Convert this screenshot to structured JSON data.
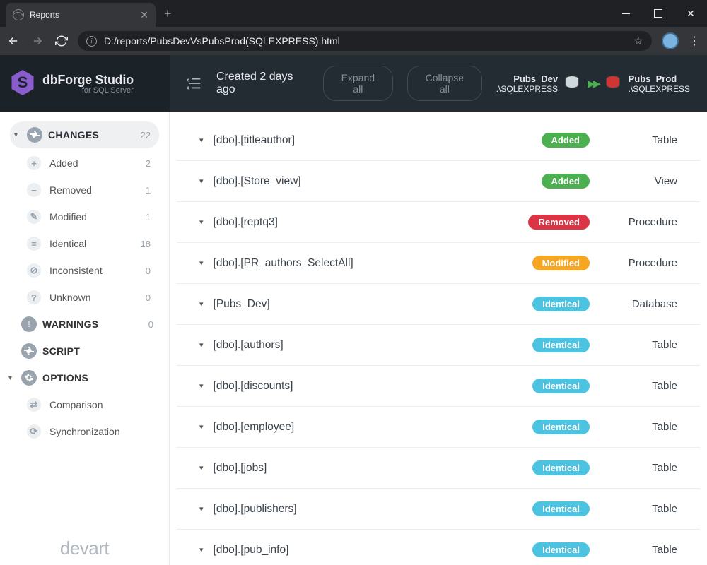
{
  "browser": {
    "tab_title": "Reports",
    "url": "D:/reports/PubsDevVsPubsProd(SQLEXPRESS).html"
  },
  "brand": {
    "title": "dbForge Studio",
    "subtitle": "for SQL Server"
  },
  "header": {
    "created": "Created 2 days ago",
    "expand": "Expand all",
    "collapse": "Collapse all",
    "src_name": "Pubs_Dev",
    "src_srv": ".\\SQLEXPRESS",
    "tgt_name": "Pubs_Prod",
    "tgt_srv": ".\\SQLEXPRESS"
  },
  "sidebar": {
    "changes": {
      "label": "CHANGES",
      "count": "22"
    },
    "items": [
      {
        "label": "Added",
        "count": "2",
        "sym": "+"
      },
      {
        "label": "Removed",
        "count": "1",
        "sym": "−"
      },
      {
        "label": "Modified",
        "count": "1",
        "sym": "✎"
      },
      {
        "label": "Identical",
        "count": "18",
        "sym": "="
      },
      {
        "label": "Inconsistent",
        "count": "0",
        "sym": "⊘"
      },
      {
        "label": "Unknown",
        "count": "0",
        "sym": "?"
      }
    ],
    "warnings": {
      "label": "WARNINGS",
      "count": "0"
    },
    "script": {
      "label": "SCRIPT"
    },
    "options": {
      "label": "OPTIONS"
    },
    "opt_items": [
      {
        "label": "Comparison"
      },
      {
        "label": "Synchronization"
      }
    ],
    "footer": "devart"
  },
  "rows": [
    {
      "name": "[dbo].[titleauthor]",
      "status": "Added",
      "type": "Table"
    },
    {
      "name": "[dbo].[Store_view]",
      "status": "Added",
      "type": "View"
    },
    {
      "name": "[dbo].[reptq3]",
      "status": "Removed",
      "type": "Procedure"
    },
    {
      "name": "[dbo].[PR_authors_SelectAll]",
      "status": "Modified",
      "type": "Procedure"
    },
    {
      "name": "[Pubs_Dev]",
      "status": "Identical",
      "type": "Database"
    },
    {
      "name": "[dbo].[authors]",
      "status": "Identical",
      "type": "Table"
    },
    {
      "name": "[dbo].[discounts]",
      "status": "Identical",
      "type": "Table"
    },
    {
      "name": "[dbo].[employee]",
      "status": "Identical",
      "type": "Table"
    },
    {
      "name": "[dbo].[jobs]",
      "status": "Identical",
      "type": "Table"
    },
    {
      "name": "[dbo].[publishers]",
      "status": "Identical",
      "type": "Table"
    },
    {
      "name": "[dbo].[pub_info]",
      "status": "Identical",
      "type": "Table"
    }
  ]
}
